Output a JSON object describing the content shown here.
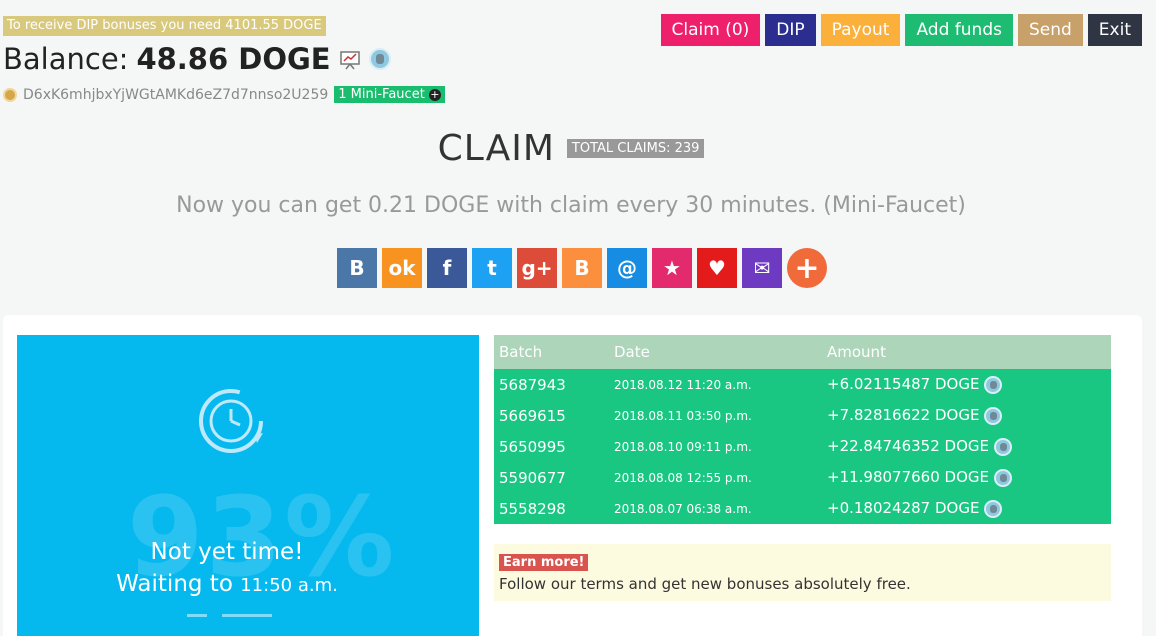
{
  "notice": "To receive DIP bonuses you need 4101.55 DOGE",
  "balance": {
    "label": "Balance:",
    "amount": "48.86 DOGE"
  },
  "address": {
    "value": "D6xK6mhjbxYjWGtAMKd6eZ7d7nnso2U259",
    "badge": "1 Mini-Faucet"
  },
  "nav": [
    {
      "label": "Claim (0)",
      "color": "#ee1f6b"
    },
    {
      "label": "DIP",
      "color": "#2b2d8f"
    },
    {
      "label": "Payout",
      "color": "#fbb03b"
    },
    {
      "label": "Add funds",
      "color": "#1ebc73"
    },
    {
      "label": "Send",
      "color": "#c8a069"
    },
    {
      "label": "Exit",
      "color": "#2f3542"
    }
  ],
  "claim": {
    "title": "CLAIM",
    "total": "TOTAL CLAIMS: 239"
  },
  "subline": "Now you can get 0.21 DOGE with claim every 30 minutes. (Mini-Faucet)",
  "shares": [
    {
      "icon": "vk-icon",
      "glyph": "B",
      "color": "#4a76a8"
    },
    {
      "icon": "odnoklassniki-icon",
      "glyph": "ok",
      "color": "#f7931e"
    },
    {
      "icon": "facebook-icon",
      "glyph": "f",
      "color": "#3b5998"
    },
    {
      "icon": "twitter-icon",
      "glyph": "t",
      "color": "#1da1f2"
    },
    {
      "icon": "google-plus-icon",
      "glyph": "g+",
      "color": "#dd4b39"
    },
    {
      "icon": "blogger-icon",
      "glyph": "B",
      "color": "#fb8f3d"
    },
    {
      "icon": "mail-ru-icon",
      "glyph": "@",
      "color": "#168de2"
    },
    {
      "icon": "livejournal-icon",
      "glyph": "★",
      "color": "#e32a6c"
    },
    {
      "icon": "surfingbird-icon",
      "glyph": "♥",
      "color": "#e41b1b"
    },
    {
      "icon": "email-icon",
      "glyph": "✉",
      "color": "#6e3ac2"
    },
    {
      "icon": "more-share-icon",
      "glyph": "+",
      "color": "#f06a3a"
    }
  ],
  "timer": {
    "percent": "93%",
    "line1": "Not yet time!",
    "line2": "Waiting to",
    "time": "11:50 a.m."
  },
  "table": {
    "headers": [
      "Batch",
      "Date",
      "Amount"
    ],
    "rows": [
      {
        "batch": "5687943",
        "date": "2018.08.12 11:20 a.m.",
        "amount": "+6.02115487 DOGE"
      },
      {
        "batch": "5669615",
        "date": "2018.08.11 03:50 p.m.",
        "amount": "+7.82816622 DOGE"
      },
      {
        "batch": "5650995",
        "date": "2018.08.10 09:11 p.m.",
        "amount": "+22.84746352 DOGE"
      },
      {
        "batch": "5590677",
        "date": "2018.08.08 12:55 p.m.",
        "amount": "+11.98077660 DOGE"
      },
      {
        "batch": "5558298",
        "date": "2018.08.07 06:38 a.m.",
        "amount": "+0.18024287 DOGE"
      }
    ]
  },
  "earn": {
    "badge": "Earn more!",
    "text": "Follow our terms and get new bonuses absolutely free."
  }
}
